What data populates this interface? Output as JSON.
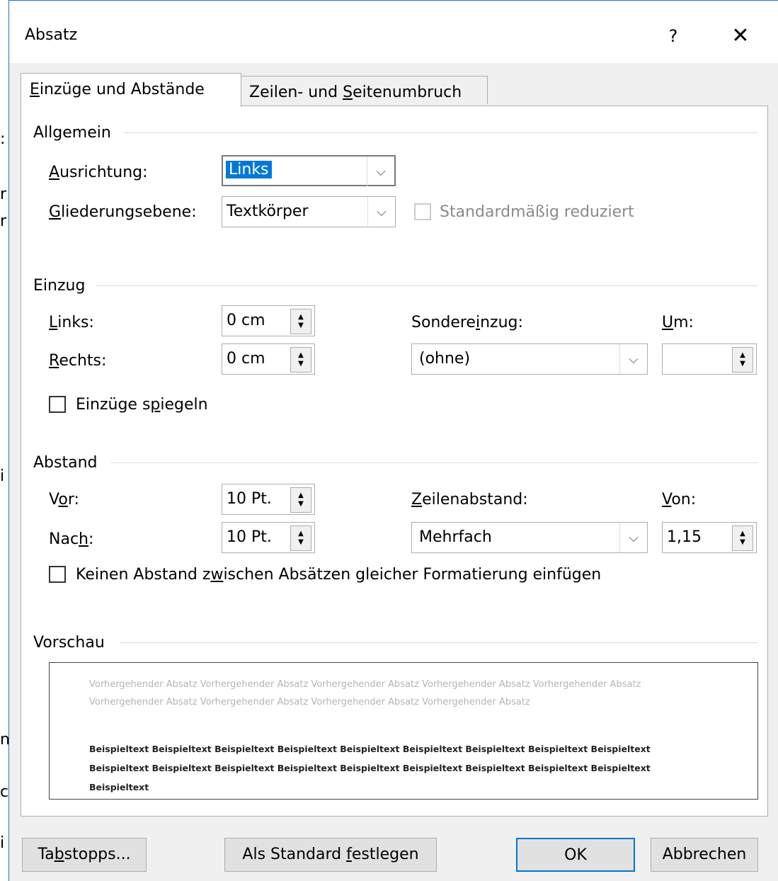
{
  "dialog": {
    "title": "Absatz",
    "help": "?",
    "close": "✕"
  },
  "tabs": [
    {
      "pre": "",
      "key": "E",
      "post": "inzüge und Abstände"
    },
    {
      "pre": "Zeilen- und ",
      "key": "S",
      "post": "eitenumbruch"
    }
  ],
  "allgemein": {
    "section": "Allgemein",
    "ausrichtung_key": "A",
    "ausrichtung_rest": "usrichtung:",
    "ausrichtung_value": "Links",
    "gliederung_key": "G",
    "gliederung_rest": "liederungsebene:",
    "gliederung_value": "Textkörper",
    "reduziert_label": "Standardmäßig reduziert"
  },
  "einzug": {
    "section": "Einzug",
    "links_key": "L",
    "links_rest": "inks:",
    "links_value": "0 cm",
    "rechts_key": "R",
    "rechts_rest": "echts:",
    "rechts_value": "0 cm",
    "sonder_pre": "Sondere",
    "sonder_key": "i",
    "sonder_post": "nzug:",
    "sonder_value": "(ohne)",
    "um_key": "U",
    "um_rest": "m:",
    "um_value": "",
    "spiegeln_pre": "Einzüge s",
    "spiegeln_key": "p",
    "spiegeln_post": "iegeln"
  },
  "abstand": {
    "section": "Abstand",
    "vor_pre": "V",
    "vor_key": "o",
    "vor_post": "r:",
    "vor_value": "10 Pt.",
    "nach_pre": "Nac",
    "nach_key": "h",
    "nach_post": ":",
    "nach_value": "10 Pt.",
    "zeilen_key": "Z",
    "zeilen_rest": "eilenabstand:",
    "zeilen_value": "Mehrfach",
    "von_key": "V",
    "von_rest": "on:",
    "von_value": "1,15",
    "keinen_pre": "Keinen Abstand z",
    "keinen_key": "w",
    "keinen_post": "ischen Absätzen gleicher Formatierung einfügen"
  },
  "vorschau": {
    "section": "Vorschau",
    "previous_text": "Vorhergehender Absatz Vorhergehender Absatz Vorhergehender Absatz Vorhergehender Absatz Vorhergehender Absatz Vorhergehender Absatz Vorhergehender Absatz Vorhergehender Absatz Vorhergehender Absatz",
    "sample_text": "Beispieltext Beispieltext Beispieltext Beispieltext Beispieltext Beispieltext Beispieltext Beispieltext Beispieltext Beispieltext Beispieltext Beispieltext Beispieltext Beispieltext Beispieltext Beispieltext Beispieltext Beispieltext Beispieltext"
  },
  "buttons": {
    "tabstopps_pre": "Ta",
    "tabstopps_key": "b",
    "tabstopps_post": "stopps...",
    "standard_pre": "Als Standard ",
    "standard_key": "f",
    "standard_post": "estlegen",
    "ok": "OK",
    "cancel": "Abbrechen"
  },
  "background_chars": [
    ":",
    "r",
    "r",
    "i",
    "n",
    "c",
    "i"
  ],
  "colors": {
    "accent": "#0078d7",
    "window_border": "#1e73be",
    "dialog_bg": "#f0f0f0"
  }
}
